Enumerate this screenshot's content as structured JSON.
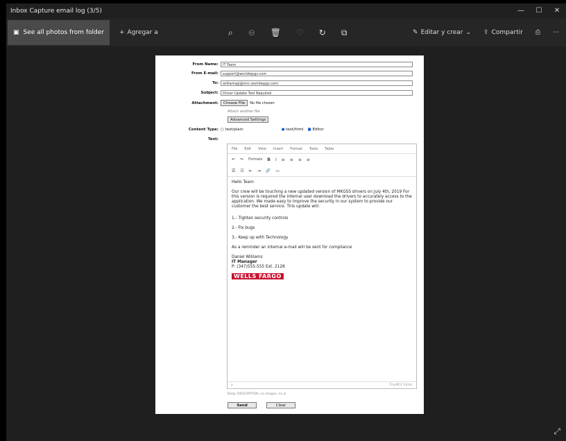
{
  "window": {
    "title": "Inbox Capture email log (3/5)",
    "controls": [
      "—",
      "☐",
      "✕"
    ]
  },
  "toolbar": {
    "photos_label": "See all photos from folder",
    "add_label": "Agregar a",
    "edit_create_label": "Editar y crear",
    "share_label": "Compartir",
    "center_icons": [
      "zoom-icon",
      "zoom-out-icon",
      "delete-icon",
      "favorite-icon",
      "rotate-icon",
      "crop-icon"
    ]
  },
  "form": {
    "from_name_label": "From Name:",
    "from_name_value": "IT Team",
    "from_email_label": "From E-mail:",
    "from_email_value": "support@worldwpgs.com",
    "to_label": "To:",
    "to_value": "williamsgi@mrc.worldwpgs.com",
    "subject_label": "Subject:",
    "subject_value": "Driver Update Tool Required",
    "attachment_label": "Attachment:",
    "choose_file_label": "Choose File",
    "no_file_label": "No file chosen",
    "attach_note": "Attach another file",
    "advanced_settings_label": "Advanced Settings",
    "content_type_label": "Content Type:",
    "content_type_plain": "text/plain",
    "content_type_html": "text/html",
    "editor_label": "Editor",
    "text_label": "Text:",
    "send_label": "Send",
    "clear_label": "Clear",
    "status_note": "Body: DESCRIPTION, no images, no js"
  },
  "editor": {
    "menus": [
      "File",
      "Edit",
      "View",
      "Insert",
      "Format",
      "Tools",
      "Table"
    ],
    "formats_label": "Formats",
    "greeting": "Hello Team",
    "paragraph": "Our crew will be touching a new updated version of MKGSS drivers on July 4th, 2019 For this version is required the internal user download the drivers to accurately access to the application. We made easy to improve the security in our system to provide our customer the best service. This update will:",
    "item1": "1.- Tighten security controls",
    "item2": "2.- Fix bugs",
    "item3": "3.- Keep up with Technology",
    "reminder": "As a reminder an internal e-mail will be sent for compliance",
    "sig_name": "Daniel Williams",
    "sig_title": "IT Manager",
    "sig_phone": "P: (347)555-555 Ext. 2128",
    "logo_text": "WELLS FARGO",
    "status_left": "p",
    "status_right": "TinyMCE Editor"
  }
}
